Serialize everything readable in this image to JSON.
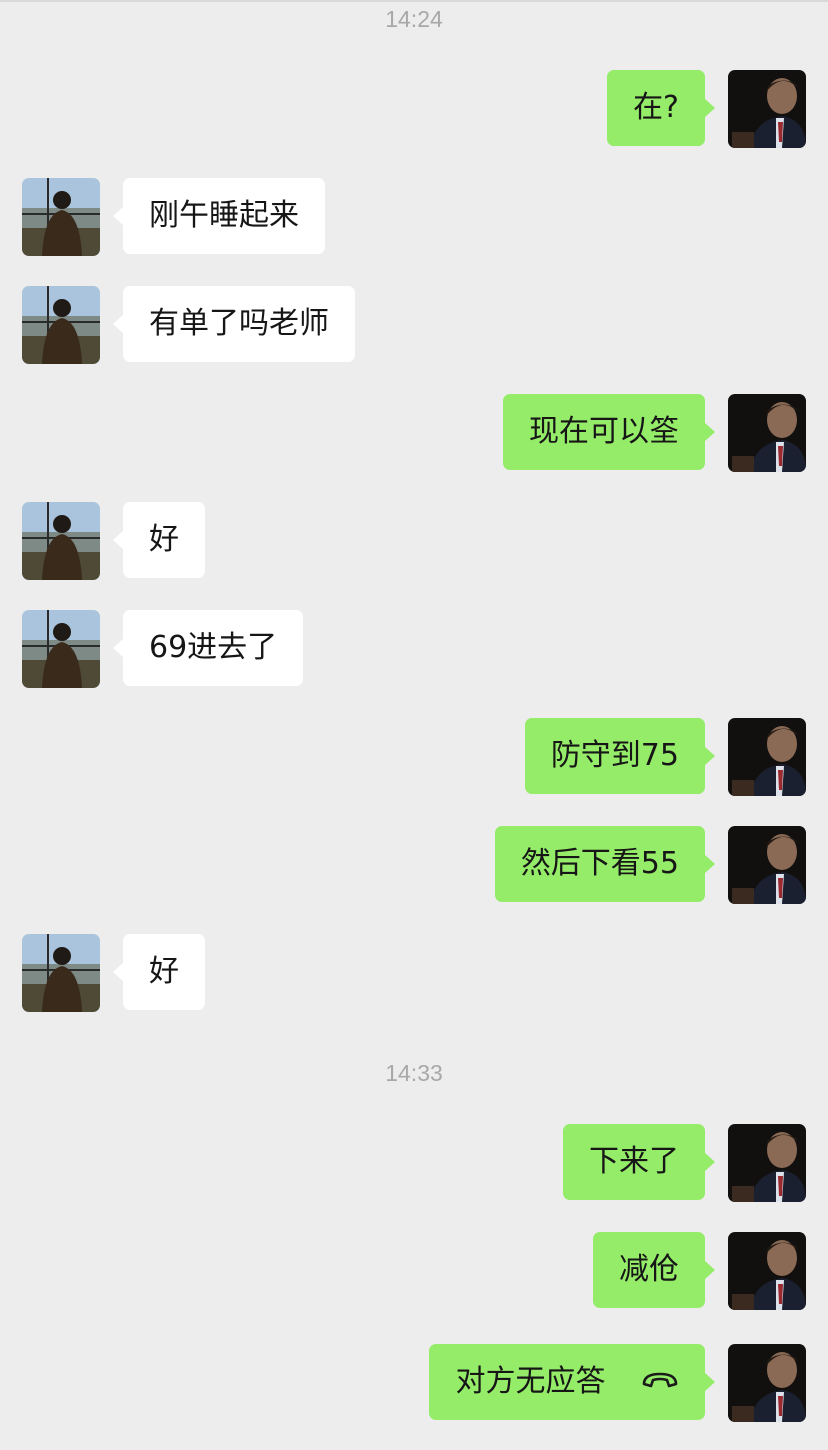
{
  "chat": {
    "timestamps": [
      "14:24",
      "14:33"
    ],
    "messages": [
      {
        "from": "me",
        "text": "在?"
      },
      {
        "from": "them",
        "text": "刚午睡起来"
      },
      {
        "from": "them",
        "text": "有单了吗老师"
      },
      {
        "from": "me",
        "text": "现在可以筌"
      },
      {
        "from": "them",
        "text": "好"
      },
      {
        "from": "them",
        "text": "69进去了"
      },
      {
        "from": "me",
        "text": "防守到75"
      },
      {
        "from": "me",
        "text": "然后下看55"
      },
      {
        "from": "them",
        "text": "好"
      },
      {
        "from": "me",
        "text": "下来了"
      },
      {
        "from": "me",
        "text": "减伧"
      },
      {
        "from": "me",
        "text": "对方无应答",
        "icon": "phone-hangup-icon"
      }
    ]
  },
  "colors": {
    "background": "#ededed",
    "my_bubble": "#95ec69",
    "their_bubble": "#ffffff",
    "timestamp": "#a8a8a8"
  }
}
